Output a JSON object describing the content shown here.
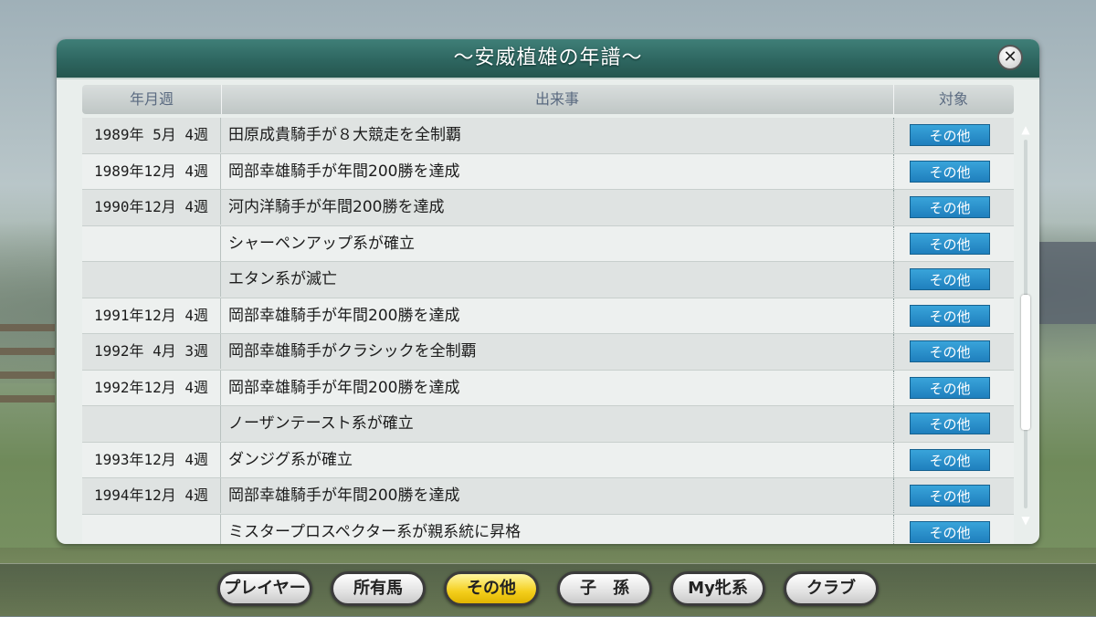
{
  "window": {
    "title": "～安威植雄の年譜～"
  },
  "table": {
    "headers": {
      "date": "年月週",
      "event": "出来事",
      "target": "対象"
    },
    "rows": [
      {
        "date": "1989年 5月 4週",
        "event": "田原成貴騎手が８大競走を全制覇",
        "target": "その他"
      },
      {
        "date": "1989年12月 4週",
        "event": "岡部幸雄騎手が年間200勝を達成",
        "target": "その他"
      },
      {
        "date": "1990年12月 4週",
        "event": "河内洋騎手が年間200勝を達成",
        "target": "その他"
      },
      {
        "date": "",
        "event": "シャーペンアップ系が確立",
        "target": "その他"
      },
      {
        "date": "",
        "event": "エタン系が滅亡",
        "target": "その他"
      },
      {
        "date": "1991年12月 4週",
        "event": "岡部幸雄騎手が年間200勝を達成",
        "target": "その他"
      },
      {
        "date": "1992年 4月 3週",
        "event": "岡部幸雄騎手がクラシックを全制覇",
        "target": "その他"
      },
      {
        "date": "1992年12月 4週",
        "event": "岡部幸雄騎手が年間200勝を達成",
        "target": "その他"
      },
      {
        "date": "",
        "event": "ノーザンテースト系が確立",
        "target": "その他"
      },
      {
        "date": "1993年12月 4週",
        "event": "ダンジグ系が確立",
        "target": "その他"
      },
      {
        "date": "1994年12月 4週",
        "event": "岡部幸雄騎手が年間200勝を達成",
        "target": "その他"
      },
      {
        "date": "",
        "event": "ミスタープロスペクター系が親系統に昇格",
        "target": "その他"
      }
    ]
  },
  "tabs": [
    {
      "label": "プレイヤー",
      "active": false
    },
    {
      "label": "所有馬",
      "active": false
    },
    {
      "label": "その他",
      "active": true
    },
    {
      "label": "子　孫",
      "active": false
    },
    {
      "label": "My牝系",
      "active": false
    },
    {
      "label": "クラブ",
      "active": false
    }
  ],
  "icons": {
    "close": "close-icon",
    "scroll_up": "arrow-up-icon",
    "scroll_down": "arrow-down-icon"
  },
  "colors": {
    "titlebar": "#2e6660",
    "target_badge": "#1f7fbd",
    "active_tab": "#f4cf1c"
  }
}
